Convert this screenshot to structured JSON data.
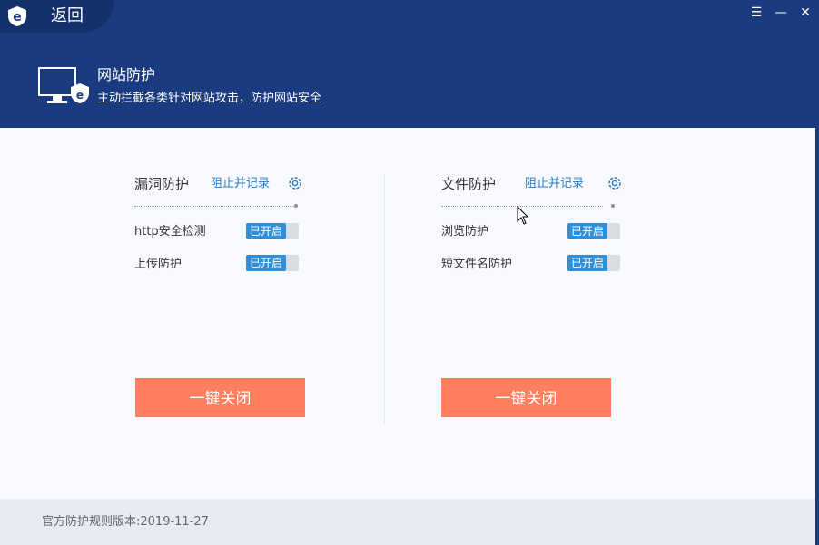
{
  "nav": {
    "back_label": "返回"
  },
  "window_controls": {
    "menu": "☰",
    "minimize": "—",
    "close": "✕"
  },
  "header": {
    "title": "网站防护",
    "subtitle": "主动拦截各类针对网站攻击，防护网站安全"
  },
  "panels": [
    {
      "title": "漏洞防护",
      "mode_link": "阻止并记录",
      "items": [
        {
          "label": "http安全检测",
          "status": "已开启"
        },
        {
          "label": "上传防护",
          "status": "已开启"
        }
      ],
      "close_all_label": "一键关闭"
    },
    {
      "title": "文件防护",
      "mode_link": "阻止并记录",
      "items": [
        {
          "label": "浏览防护",
          "status": "已开启"
        },
        {
          "label": "短文件名防护",
          "status": "已开启"
        }
      ],
      "close_all_label": "一键关闭"
    }
  ],
  "footer": {
    "rules_version": "官方防护规则版本:2019-11-27"
  },
  "icons": {
    "logo": "shield-e-icon",
    "monitor": "monitor-shield-icon",
    "settings": "gear-icon"
  },
  "colors": {
    "header_bg": "#1a3b80",
    "toggle_on": "#2f8fd8",
    "close_button": "#ff7f5f",
    "link": "#2a7ec8"
  }
}
